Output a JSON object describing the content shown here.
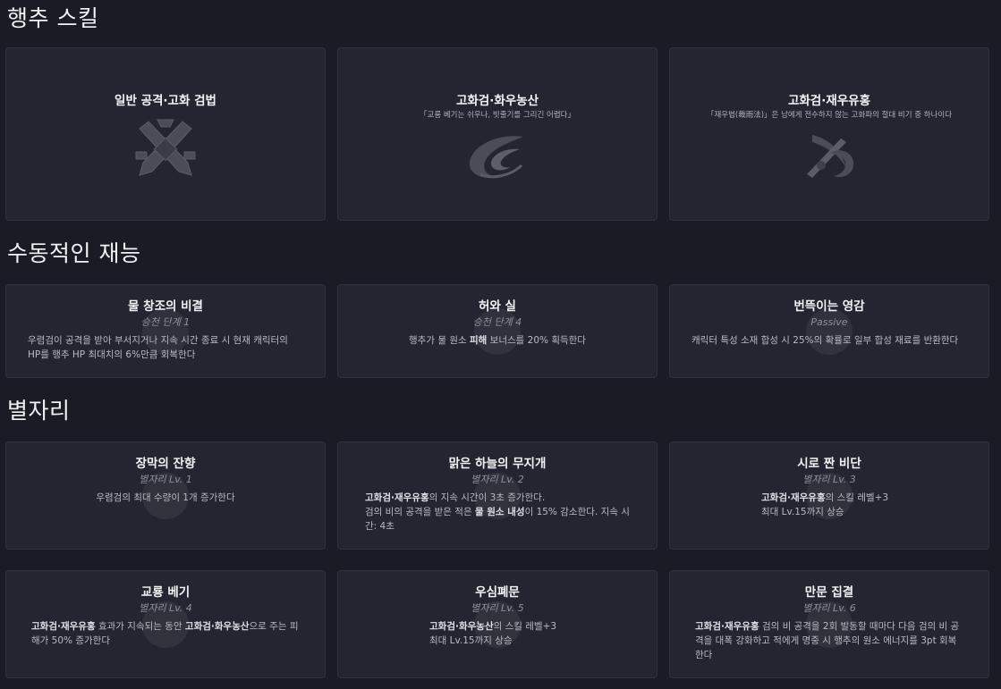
{
  "sections": {
    "skills": "행추 스킬",
    "passives": "수동적인 재능",
    "constellations": "별자리"
  },
  "skills": [
    {
      "name": "일반 공격·고화 검법",
      "quote": "",
      "icon": "crossed-swords-icon"
    },
    {
      "name": "고화검·화우농산",
      "quote": "「교룡 베기는 쉬우나, 빗줄기를 그리긴 어렵다」",
      "icon": "water-wave-icon"
    },
    {
      "name": "고화검·재우유홍",
      "quote": "「재우법(裁雨法)」은 남에게 전수하지 않는 고화파의 절대 비기 중 하나이다",
      "icon": "rain-sword-icon"
    }
  ],
  "passives": [
    {
      "name": "물 창조의 비결",
      "sub": "승천 단계 1",
      "desc_parts": [
        {
          "t": "우렴검이 공격을 받아 부서지거나 지속 시간 종료 시 현재 캐릭터의 HP를 행추 HP 최대치의 6%만큼 회복한다",
          "b": false
        }
      ]
    },
    {
      "name": "허와 실",
      "sub": "승천 단계 4",
      "desc_parts": [
        {
          "t": "행추가 물 원소 ",
          "b": false
        },
        {
          "t": "피해",
          "b": true
        },
        {
          "t": " 보너스를 20% 획득한다",
          "b": false
        }
      ]
    },
    {
      "name": "번뜩이는 영감",
      "sub": "Passive",
      "desc_parts": [
        {
          "t": "캐릭터 특성 소재 합성 시 25%의 확률로 일부 합성 재료를 반환한다",
          "b": false
        }
      ]
    }
  ],
  "constellations": [
    {
      "name": "장막의 잔향",
      "sub": "별자리 Lv. 1",
      "desc_parts": [
        {
          "t": "우렴검의 최대 수량이 1개 증가한다",
          "b": false
        }
      ]
    },
    {
      "name": "맑은 하늘의 무지개",
      "sub": "별자리 Lv. 2",
      "desc_parts": [
        {
          "t": "고화검·재우유홍",
          "b": true
        },
        {
          "t": "의 지속 시간이 3초 증가한다.\n검의 비의 공격을 받은 적은 ",
          "b": false
        },
        {
          "t": "물 원소 내성",
          "b": true
        },
        {
          "t": "이 15% 감소한다. 지속 시간: 4초",
          "b": false
        }
      ]
    },
    {
      "name": "시로 짠 비단",
      "sub": "별자리 Lv. 3",
      "desc_parts": [
        {
          "t": "고화검·재우유홍",
          "b": true
        },
        {
          "t": "의 스킬 레벨+3\n최대 Lv.15까지 상승",
          "b": false
        }
      ]
    },
    {
      "name": "교룡 베기",
      "sub": "별자리 Lv. 4",
      "desc_parts": [
        {
          "t": "고화검·재우유홍",
          "b": true
        },
        {
          "t": " 효과가 지속되는 동안 ",
          "b": false
        },
        {
          "t": "고화검·화우농산",
          "b": true
        },
        {
          "t": "으로 주는 피해가 50% 증가한다",
          "b": false
        }
      ]
    },
    {
      "name": "우심폐문",
      "sub": "별자리 Lv. 5",
      "desc_parts": [
        {
          "t": "고화검·화우농산",
          "b": true
        },
        {
          "t": "의 스킬 레벨+3\n최대 Lv.15까지 상승",
          "b": false
        }
      ]
    },
    {
      "name": "만문 집결",
      "sub": "별자리 Lv. 6",
      "desc_parts": [
        {
          "t": "고화검·재우유홍",
          "b": true
        },
        {
          "t": " 검의 비 공격을 2회 발동할 때마다 다음 검의 비 공격을 대폭 강화하고 적에게 명중 시 행추의 원소 에너지를 3pt 회복한다",
          "b": false
        }
      ]
    }
  ]
}
